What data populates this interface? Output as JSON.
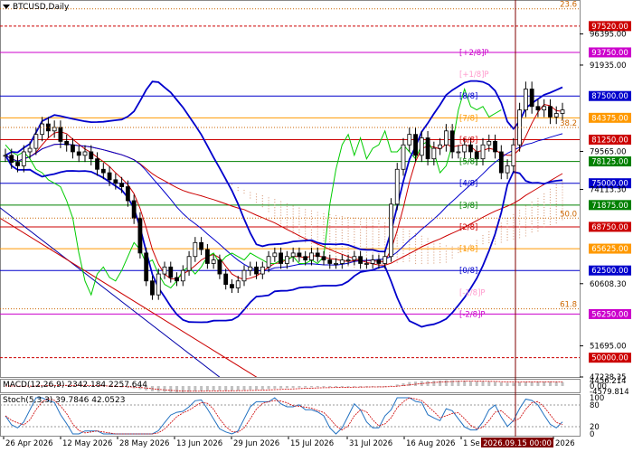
{
  "symbol": "BTCUSD,Daily",
  "colors": {
    "price_up": "#000000",
    "price_down": "#000000",
    "bollinger": "#0000cc",
    "ma_red": "#cc0000",
    "ma_green": "#00cc00",
    "ichimoku": "#d9a080",
    "macd_hist": "#c0c0c0",
    "macd_signal": "#cc0000",
    "stoch_main": "#2070c0",
    "stoch_signal": "#cc0000",
    "blue_level": "#0000cc",
    "red_level": "#cc0000",
    "orange_level": "#ff9900",
    "magenta_level": "#cc00cc",
    "pink_level": "#ff99cc",
    "green_level": "#008000",
    "brown_level": "#8b4513",
    "cursor_line": "#800000"
  },
  "price_levels": [
    {
      "value": "97520.00",
      "color": "#cc0000",
      "label_color": "#ffffff"
    },
    {
      "value": "93750.00",
      "color": "#cc00cc",
      "label_color": "#ffffff"
    },
    {
      "value": "87500.00",
      "color": "#0000cc",
      "label_color": "#ffffff"
    },
    {
      "value": "84375.00",
      "color": "#ff9900",
      "label_color": "#ffffff"
    },
    {
      "value": "81250.00",
      "color": "#cc0000",
      "label_color": "#ffffff"
    },
    {
      "value": "78125.00",
      "color": "#008000",
      "label_color": "#ffffff"
    },
    {
      "value": "75000.00",
      "color": "#0000cc",
      "label_color": "#ffffff"
    },
    {
      "value": "71875.00",
      "color": "#008000",
      "label_color": "#ffffff"
    },
    {
      "value": "68750.00",
      "color": "#cc0000",
      "label_color": "#ffffff"
    },
    {
      "value": "65625.00",
      "color": "#ff9900",
      "label_color": "#ffffff"
    },
    {
      "value": "62500.00",
      "color": "#0000cc",
      "label_color": "#ffffff"
    },
    {
      "value": "56250.00",
      "color": "#cc00cc",
      "label_color": "#ffffff"
    },
    {
      "value": "50000.00",
      "color": "#cc0000",
      "label_color": "#ffffff"
    }
  ],
  "axis_prices": [
    "96395.00",
    "91935.00",
    "79565.00",
    "74113.30",
    "60608.30",
    "51695.00",
    "47238.35"
  ],
  "murrey_labels": [
    {
      "text": "[+2/8]P",
      "color": "#cc00cc"
    },
    {
      "text": "[+1/8]P",
      "color": "#ff99cc"
    },
    {
      "text": "[8/8]",
      "color": "#0000cc"
    },
    {
      "text": "[7/8]",
      "color": "#ff9900"
    },
    {
      "text": "[6/8]",
      "color": "#cc0000"
    },
    {
      "text": "[5/8]",
      "color": "#008000"
    },
    {
      "text": "[4/8]",
      "color": "#0000cc"
    },
    {
      "text": "[3/8]",
      "color": "#008000"
    },
    {
      "text": "[2/8]",
      "color": "#cc0000"
    },
    {
      "text": "[1/8]",
      "color": "#ff9900"
    },
    {
      "text": "[0/8]",
      "color": "#0000cc"
    },
    {
      "text": "[-1/8]P",
      "color": "#ff99cc"
    },
    {
      "text": "[-2/8]P",
      "color": "#cc00cc"
    }
  ],
  "fib_labels": [
    "23.6",
    "38.2",
    "50.0",
    "61.8"
  ],
  "macd": {
    "label": "MACD(12,26,9) 2342.184 2257.644",
    "axis": [
      "4456.214",
      "0.00",
      "-4579.814"
    ]
  },
  "stoch": {
    "label": "Stoch(5,3,3) 39.7846 42.0523",
    "axis": [
      "100",
      "80",
      "20",
      "0"
    ]
  },
  "dates": [
    "26 Apr 2026",
    "12 May 2026",
    "28 May 2026",
    "13 Jun 2026",
    "29 Jun 2026",
    "15 Jul 2026",
    "31 Jul 2026",
    "16 Aug 2026",
    "1 Se",
    "2026"
  ],
  "cursor_date": "2026.09.15 00:00",
  "chart_data": {
    "type": "line",
    "title": "BTCUSD,Daily",
    "xlabel": "",
    "ylabel": "",
    "ylim": [
      47238.35,
      101000
    ],
    "series": [
      {
        "values": [
          79000,
          78000,
          77500,
          79500,
          80000,
          82000,
          83500,
          82500,
          83000,
          81000,
          80500,
          79500,
          79000,
          79500,
          78500,
          77000,
          76500,
          75500,
          75000,
          74500,
          72500,
          70000,
          65000,
          61000,
          59000,
          62000,
          63000,
          61500,
          61000,
          62500,
          64500,
          66500,
          65500,
          63500,
          64000,
          62000,
          60500,
          60000,
          61000,
          62500,
          63000,
          62000,
          63000,
          64500,
          65000,
          63500,
          64500,
          65000,
          64500,
          64000,
          65000,
          64500,
          64000,
          63500,
          63500,
          64000,
          64000,
          64500,
          63500,
          63500,
          64000,
          63500,
          64500,
          72000,
          77000,
          80500,
          82000,
          79000,
          81500,
          78500,
          80000,
          80500,
          82500,
          79500,
          79500,
          80500,
          79500,
          78500,
          80500,
          81000,
          79500,
          76500,
          77500,
          80500,
          85500,
          88500,
          86000,
          85500,
          86000,
          84500,
          85000,
          85500
        ]
      }
    ]
  }
}
